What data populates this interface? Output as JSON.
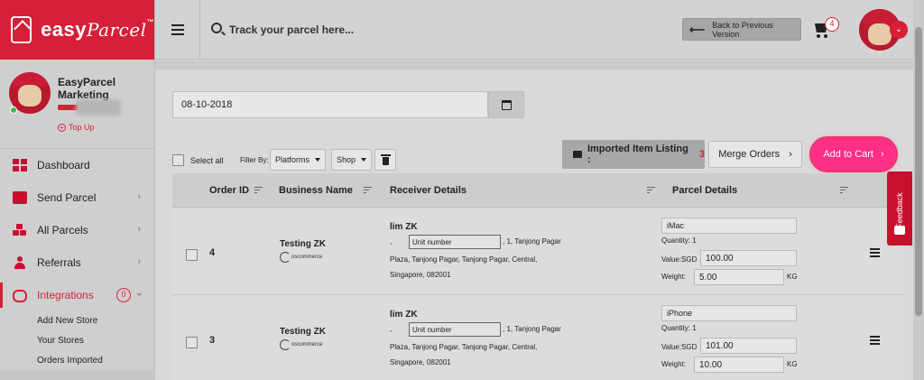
{
  "app": {
    "logo_main": "easy",
    "logo_script": "Parcel",
    "logo_tm": "™"
  },
  "header": {
    "search_placeholder": "Track your parcel here...",
    "back_button_label": "Back to Previous Version",
    "cart_count": "4"
  },
  "profile": {
    "name": "EasyParcel Marketing",
    "topup_label": "Top Up",
    "status_color": "#3cb94a"
  },
  "sidebar": {
    "items": [
      {
        "label": "Dashboard",
        "icon": "dashboard-icon"
      },
      {
        "label": "Send Parcel",
        "icon": "truck-icon"
      },
      {
        "label": "All Parcels",
        "icon": "boxes-icon"
      },
      {
        "label": "Referrals",
        "icon": "users-icon"
      },
      {
        "label": "Integrations",
        "icon": "link-icon",
        "badge": "0"
      }
    ],
    "sub_items": [
      {
        "label": "Add New Store"
      },
      {
        "label": "Your Stores"
      },
      {
        "label": "Orders Imported"
      }
    ]
  },
  "filters": {
    "date_value": "08-10-2018",
    "select_all_label": "Select all",
    "filter_by_label": "Filter By:",
    "platforms_label": "Platforms",
    "shop_label": "Shop"
  },
  "actions": {
    "imported_label": "Imported Item Listing :",
    "imported_count": "3",
    "merge_label": "Merge Orders",
    "add_to_cart_label": "Add to Cart"
  },
  "table": {
    "columns": [
      "Order ID",
      "Business Name",
      "Receiver Details",
      "Parcel Details"
    ],
    "rows": [
      {
        "order_id": "4",
        "business": "Testing ZK",
        "platform": "oscommerce",
        "receiver_name": "lim ZK",
        "comma": ",",
        "unit_placeholder": "Unit number",
        "address_line1": ", 1, Tanjong Pagar",
        "address_rest": "Plaza, Tanjong Pagar, Tanjong Pagar, Central, Singapore, 082001",
        "item": "iMac",
        "quantity": "Quantity: 1",
        "value_label": "Value:SGD",
        "value": "100.00",
        "weight_label": "Weight:",
        "weight": "5.00",
        "unit": "KG"
      },
      {
        "order_id": "3",
        "business": "Testing ZK",
        "platform": "oscommerce",
        "receiver_name": "lim ZK",
        "comma": ",",
        "unit_placeholder": "Unit number",
        "address_line1": ", 1, Tanjong Pagar",
        "address_rest": "Plaza, Tanjong Pagar, Tanjong Pagar, Central, Singapore, 082001",
        "item": "iPhone",
        "quantity": "Quantity: 1",
        "value_label": "Value:SGD",
        "value": "101.00",
        "weight_label": "Weight:",
        "weight": "10.00",
        "unit": "KG"
      }
    ]
  },
  "feedback_label": "Feedback",
  "colors": {
    "brand": "#d61f38",
    "accent_button": "#ff2e86"
  }
}
